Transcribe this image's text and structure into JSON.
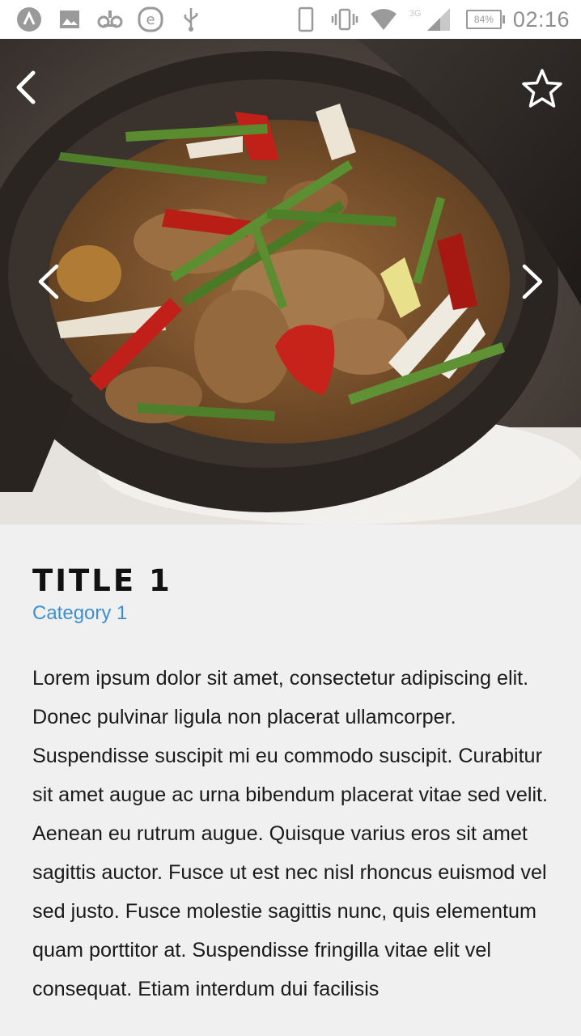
{
  "status_bar": {
    "battery": "84%",
    "time": "02:16",
    "network": "3G"
  },
  "hero": {
    "image": "claypot-stir-fry-photo",
    "controls": [
      "back-icon",
      "star-icon",
      "chevron-left-icon",
      "chevron-right-icon"
    ]
  },
  "article": {
    "title": "TITLE 1",
    "category": "Category 1",
    "body": "Lorem ipsum dolor sit amet, consectetur adipiscing elit. Donec pulvinar ligula non placerat ullamcorper. Suspendisse suscipit mi eu commodo suscipit. Curabitur sit amet augue ac urna bibendum placerat vitae sed velit. Aenean eu rutrum augue. Quisque varius eros sit amet sagittis auctor. Fusce ut est nec nisl rhoncus euismod vel sed justo. Fusce molestie sagittis nunc, quis elementum quam porttitor at. Suspendisse fringilla vitae elit vel consequat. Etiam interdum dui facilisis"
  },
  "colors": {
    "category_link": "#3d8fd1",
    "background": "#f0f0f0"
  }
}
